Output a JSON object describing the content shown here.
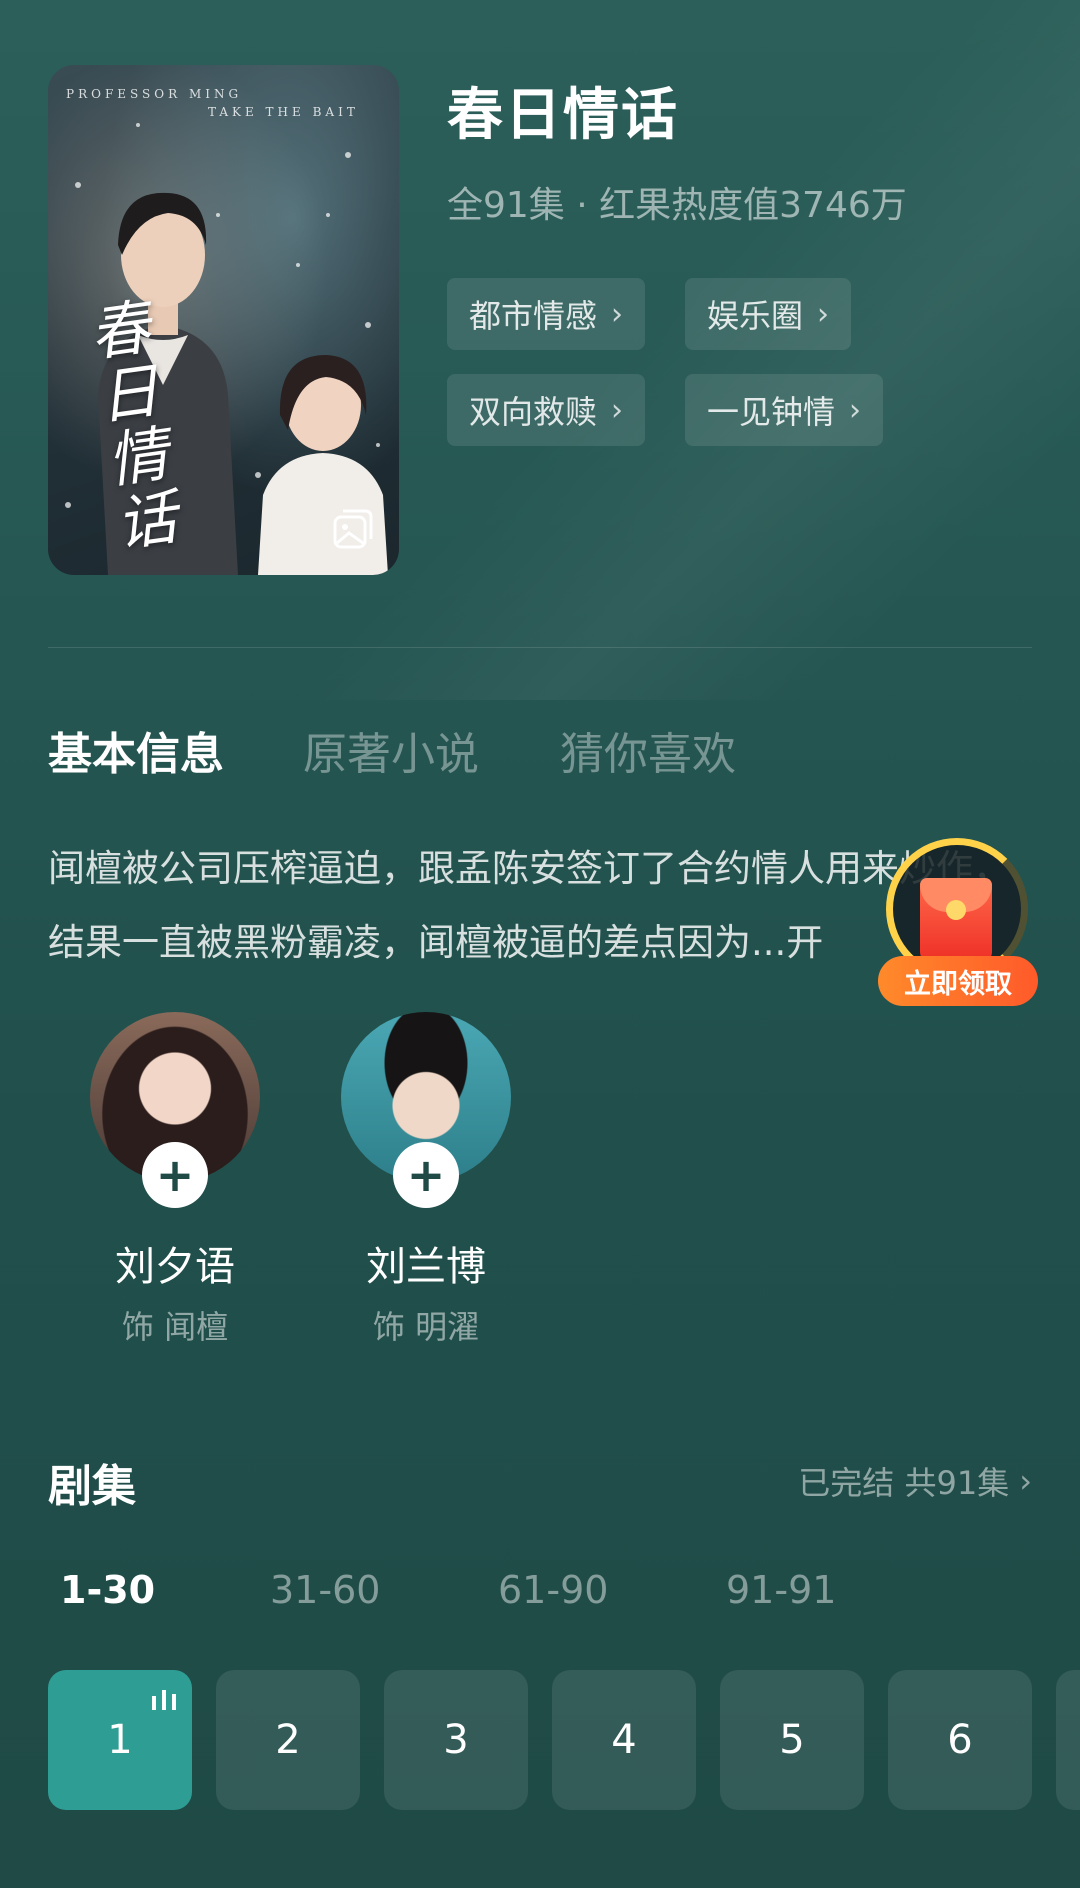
{
  "poster": {
    "english_line1": "PROFESSOR MING",
    "english_line2": "TAKE THE BAIT",
    "title_art": "春日情话"
  },
  "drama": {
    "title": "春日情话",
    "meta": "全91集 · 红果热度值3746万",
    "tags": [
      "都市情感",
      "娱乐圈",
      "双向救赎",
      "一见钟情"
    ]
  },
  "sections": {
    "tabs": [
      "基本信息",
      "原著小说",
      "猜你喜欢"
    ],
    "active": "基本信息"
  },
  "synopsis": "闻檀被公司压榨逼迫，跟孟陈安签订了合约情人用来炒作，结果一直被黑粉霸凌，闻檀被逼的差点因为...开",
  "reward": {
    "label": "立即领取"
  },
  "cast": [
    {
      "name": "刘夕语",
      "role": "饰 闻檀"
    },
    {
      "name": "刘兰博",
      "role": "饰 明濯"
    }
  ],
  "episodes": {
    "title": "剧集",
    "status": "已完结 共91集",
    "ranges": [
      "1-30",
      "31-60",
      "61-90",
      "91-91"
    ],
    "active_range": "1-30",
    "items": [
      "1",
      "2",
      "3",
      "4",
      "5",
      "6"
    ],
    "playing": "1"
  },
  "colors": {
    "background": "#265753",
    "accent": "#2e9e94",
    "reward_orange": "#ff6a2a",
    "reward_ring": "#ffd24a"
  }
}
